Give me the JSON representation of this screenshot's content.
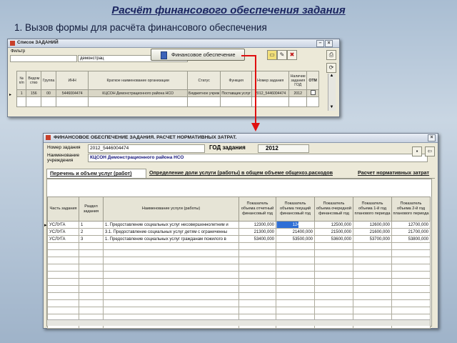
{
  "slide": {
    "title": "Расчёт финансового обеспечения задания",
    "subtitle": "1. Вызов формы для расчёта  финансового обеспечения"
  },
  "top_window": {
    "title": "Список ЗАДАНИЙ",
    "filter_label": "Фильтр",
    "filter_value": "демонстрац",
    "fin_button_label": "Финансовое обеспечение",
    "columns": [
      "№ п/п",
      "Ведом ство",
      "Группа",
      "ИНН",
      "Краткое наименование организации",
      "Статус",
      "Функция",
      "Номер задания",
      "Наличие задания ГОД",
      "ОТМ"
    ],
    "row": [
      "1",
      "156",
      "00",
      "5446004474",
      "КЦСОН Демонстрационного района НСО",
      "Бюджетное учреж",
      "Поставщик услуг",
      "2012_5446004474",
      "2012",
      ""
    ]
  },
  "bottom_window": {
    "title": "ФИНАНСОВОЕ ОБЕСПЕЧЕНИЕ ЗАДАНИЯ.   РАСЧЕТ НОРМАТИВНЫХ ЗАТРАТ.",
    "task_number_label": "Номер задания",
    "task_number_value": "2012_5446004474",
    "year_label": "ГОД задания",
    "year_value": "2012",
    "org_label": "Наименование учреждения",
    "org_value": "КЦСОН Демонстрационного района НСО",
    "tabs": [
      "Перечень и объем услуг (работ)",
      "Определение доли услуги (работы) в общем объеме общехоз.расходов",
      "Расчет нормативных затрат"
    ],
    "columns": [
      "Часть задания",
      "Раздел задания",
      "Наименование услуги (работы)",
      "Показатель объема отчетный финансовый год",
      "Показатель объема текущий финансовый год",
      "Показатель объема очередной финансовый год",
      "Показатель объема 1-й год планового периода",
      "Показатель объема 2-й год планового периода"
    ],
    "rows": [
      [
        "УСЛУГА",
        "1",
        "1. Предоставление социальных услуг несовершеннолетним и",
        "12300,000",
        "12400,000",
        "12500,000",
        "12600,000",
        "12700,000"
      ],
      [
        "УСЛУГА",
        "2",
        "3.1. Предоставление социальных услуг детям с ограниченны",
        "21300,000",
        "21400,000",
        "21500,000",
        "21600,000",
        "21700,000"
      ],
      [
        "УСЛУГА",
        "3",
        "1. Предоставление социальных услуг гражданам пожилого в",
        "53400,000",
        "53500,000",
        "53600,000",
        "53700,000",
        "53800,000"
      ]
    ]
  },
  "colors": {
    "accent": "#1b2560",
    "arrow": "#e01010",
    "selected_cell": "#2f6fd6",
    "active_tab": "#ffffff"
  }
}
